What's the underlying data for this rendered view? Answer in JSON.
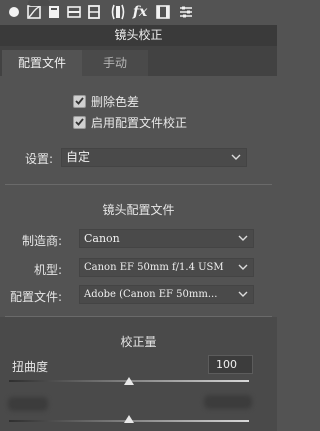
{
  "toolbar": {
    "icons": [
      "basic-panel-icon",
      "tone-curve-icon",
      "hsl-icon",
      "split-toning-icon",
      "detail-icon",
      "lens-corrections-icon",
      "effects-fx-icon",
      "camera-calibration-icon",
      "presets-icon"
    ]
  },
  "panel": {
    "title": "镜头校正"
  },
  "tabs": {
    "profile": "配置文件",
    "manual": "手动"
  },
  "options": {
    "remove_ca": {
      "label": "删除色差",
      "checked": true
    },
    "enable_profile": {
      "label": "启用配置文件校正",
      "checked": true
    }
  },
  "setup": {
    "label": "设置:",
    "value": "自定"
  },
  "lens_profile": {
    "title": "镜头配置文件",
    "make": {
      "label": "制造商:",
      "value": "Canon"
    },
    "model": {
      "label": "机型:",
      "value": "Canon EF 50mm f/1.4 USM"
    },
    "profile": {
      "label": "配置文件:",
      "value": "Adobe (Canon EF 50mm..."
    }
  },
  "amount": {
    "title": "校正量",
    "distortion": {
      "label": "扭曲度",
      "value": "100",
      "level_fraction": 0.5
    },
    "second_slider": {
      "level_fraction": 0.5
    }
  }
}
